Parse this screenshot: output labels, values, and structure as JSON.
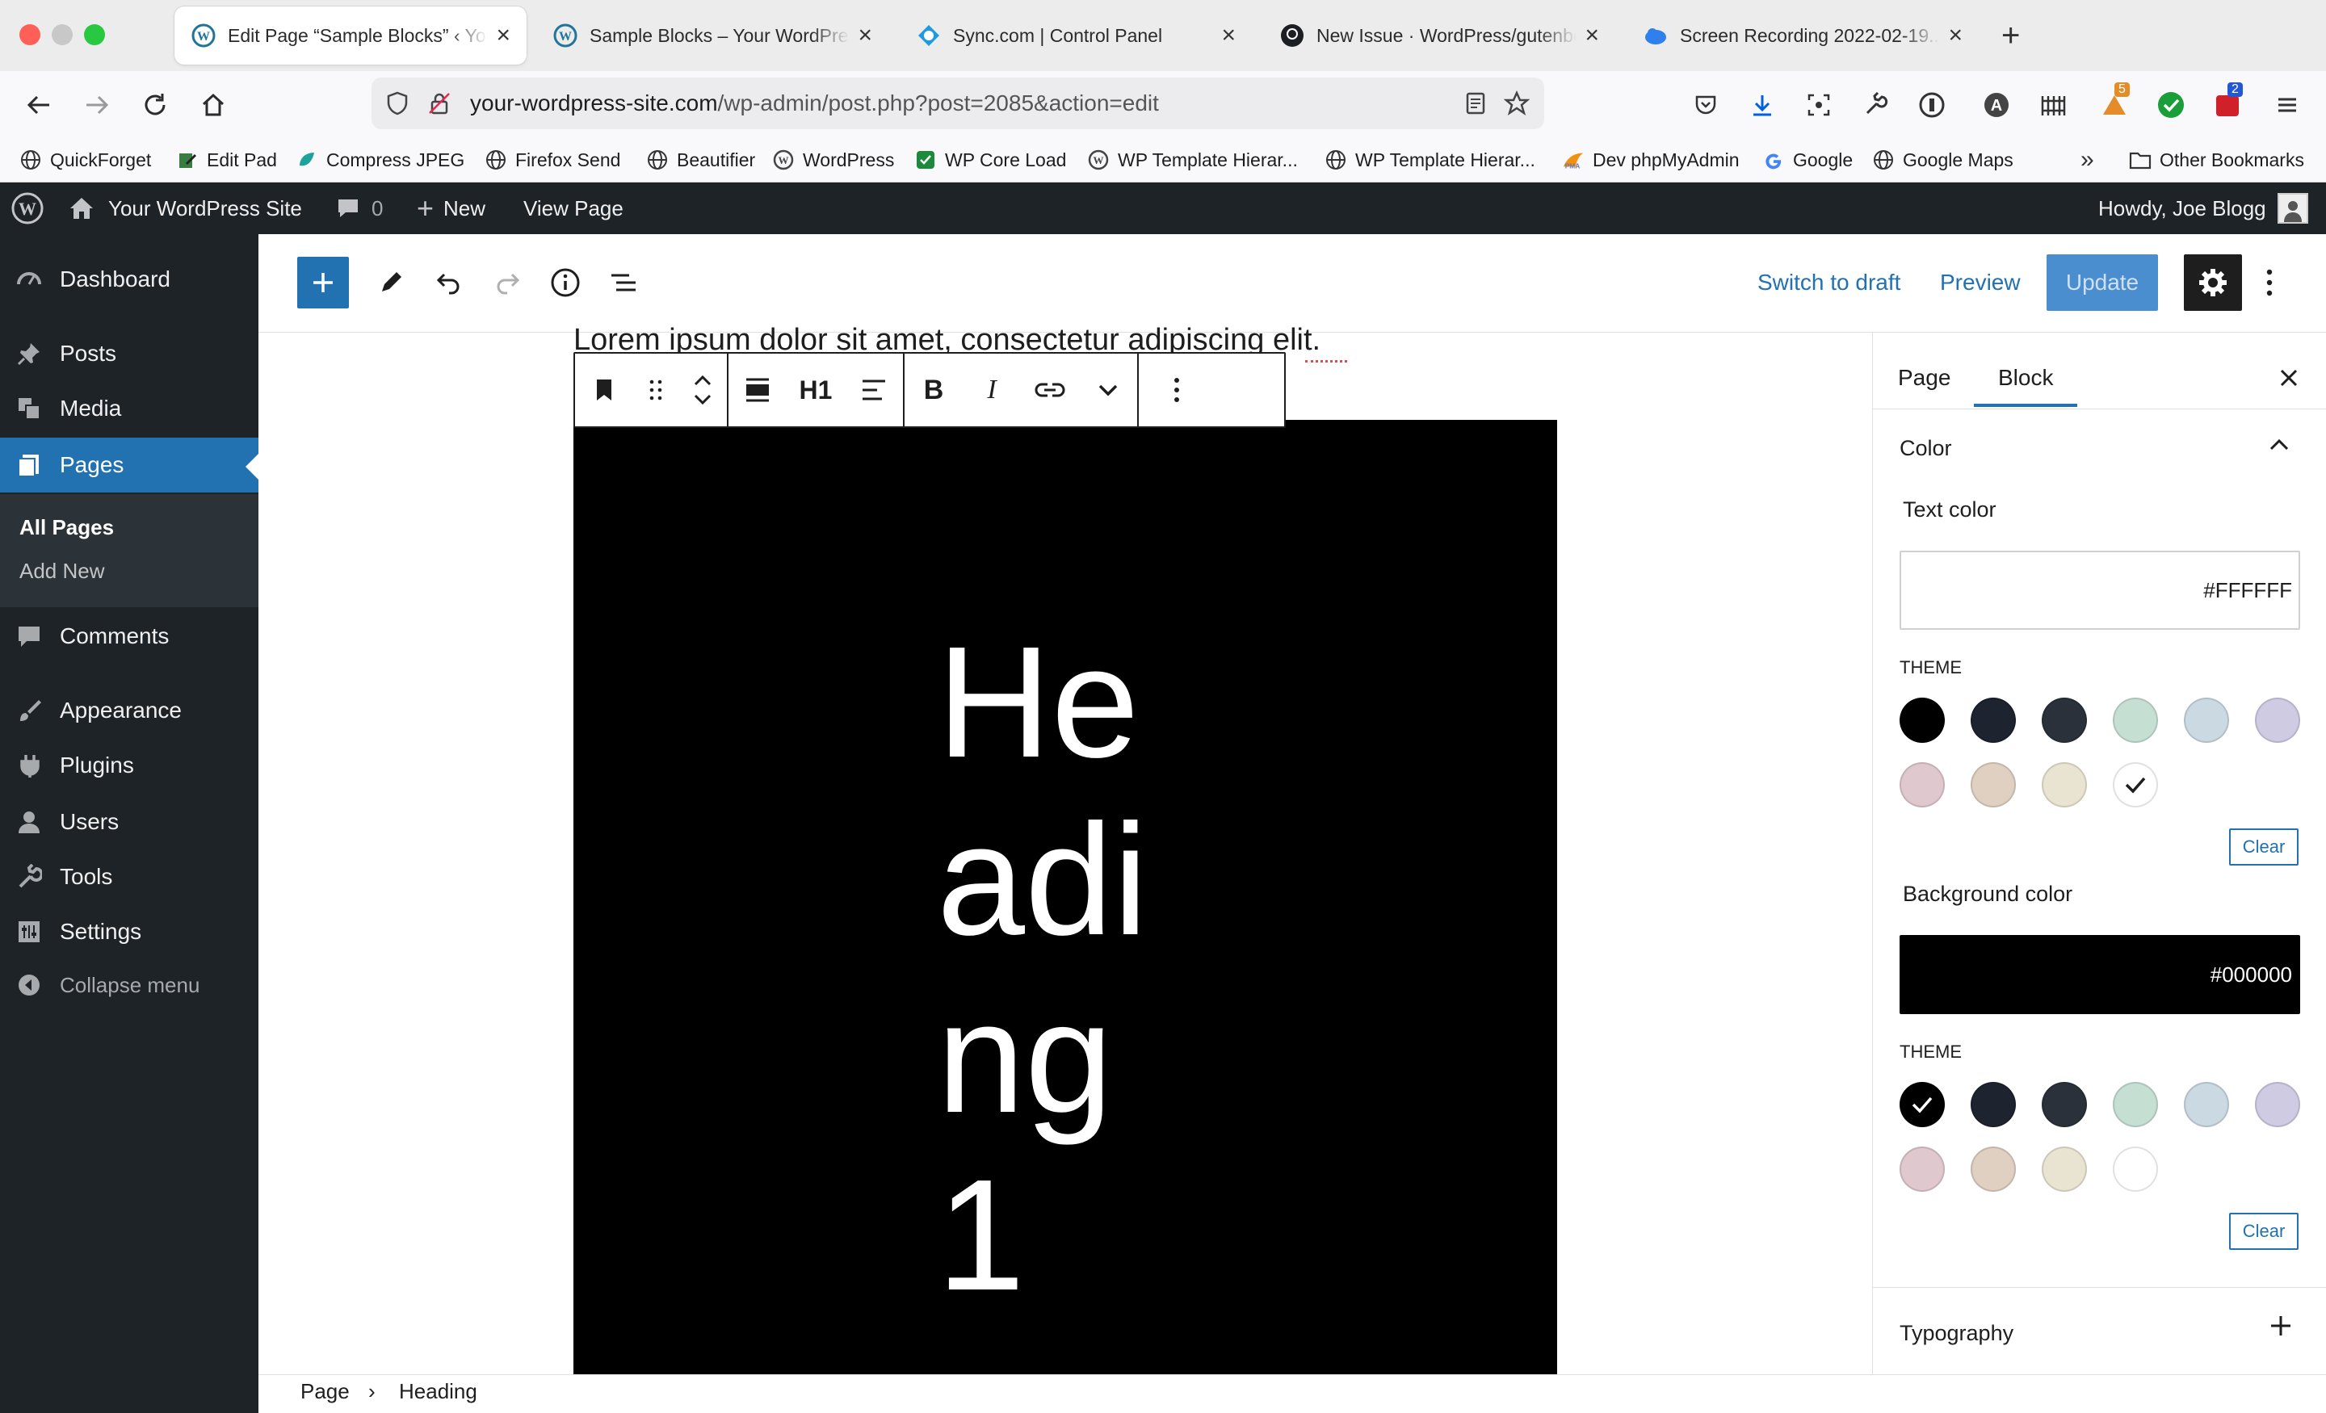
{
  "browser": {
    "tabs": [
      {
        "title": "Edit Page “Sample Blocks” ‹ Your WordPress Site",
        "favicon": "wordpress-icon",
        "active": true
      },
      {
        "title": "Sample Blocks – Your WordPress Site",
        "favicon": "wordpress-icon",
        "active": false
      },
      {
        "title": "Sync.com | Control Panel",
        "favicon": "sync-icon",
        "active": false
      },
      {
        "title": "New Issue · WordPress/gutenberg",
        "favicon": "github-icon",
        "active": false
      },
      {
        "title": "Screen Recording 2022-02-19...",
        "favicon": "cloudapp-icon",
        "active": false
      }
    ],
    "url_host": "your-wordpress-site.com",
    "url_path": "/wp-admin/post.php?post=2085&action=edit",
    "extension_badges": {
      "ext1": "5",
      "ext2": "2"
    },
    "bookmarks": [
      {
        "label": "QuickForget",
        "icon": "globe-icon"
      },
      {
        "label": "Edit Pad",
        "icon": "editpad-icon"
      },
      {
        "label": "Compress JPEG",
        "icon": "compress-icon"
      },
      {
        "label": "Firefox Send",
        "icon": "globe-icon"
      },
      {
        "label": "Beautifier",
        "icon": "globe-icon"
      },
      {
        "label": "WordPress",
        "icon": "wordpress-icon"
      },
      {
        "label": "WP Core Load",
        "icon": "wpcore-icon"
      },
      {
        "label": "WP Template Hierar...",
        "icon": "wordpress-icon"
      },
      {
        "label": "WP Template Hierar...",
        "icon": "globe-icon"
      },
      {
        "label": "Dev phpMyAdmin",
        "icon": "pma-icon"
      },
      {
        "label": "Google",
        "icon": "google-icon"
      },
      {
        "label": "Google Maps",
        "icon": "globe-icon"
      }
    ],
    "other_bookmarks": "Other Bookmarks"
  },
  "adminbar": {
    "site_name": "Your WordPress Site",
    "comments_count": "0",
    "new_label": "New",
    "view_label": "View Page",
    "howdy": "Howdy, Joe Blogg"
  },
  "sidebar": {
    "items": [
      {
        "label": "Dashboard",
        "icon": "dashboard-icon"
      },
      {
        "label": "Posts",
        "icon": "pin-icon"
      },
      {
        "label": "Media",
        "icon": "media-icon"
      },
      {
        "label": "Pages",
        "icon": "pages-icon"
      },
      {
        "label": "Comments",
        "icon": "comment-icon"
      },
      {
        "label": "Appearance",
        "icon": "brush-icon"
      },
      {
        "label": "Plugins",
        "icon": "plug-icon"
      },
      {
        "label": "Users",
        "icon": "user-icon"
      },
      {
        "label": "Tools",
        "icon": "wrench-icon"
      },
      {
        "label": "Settings",
        "icon": "settings-icon"
      },
      {
        "label": "Collapse menu",
        "icon": "collapse-icon"
      }
    ],
    "submenu": {
      "all_pages": "All Pages",
      "add_new": "Add New"
    }
  },
  "editor": {
    "header": {
      "switch_to_draft": "Switch to draft",
      "preview": "Preview",
      "update": "Update"
    },
    "lorem": "Lorem ipsum dolor sit amet, consectetur adipiscing elit.",
    "heading_text": "Heading 1",
    "toolbar": {
      "heading_level": "H1"
    },
    "breadcrumb": [
      "Page",
      "Heading"
    ]
  },
  "inspector": {
    "tabs": [
      "Page",
      "Block"
    ],
    "active_tab": "Block",
    "color_section": "Color",
    "text_color_label": "Text color",
    "text_color_value": "#FFFFFF",
    "theme_label": "THEME",
    "clear_label": "Clear",
    "background_color_label": "Background color",
    "background_color_value": "#000000",
    "theme_swatches": [
      "#000000",
      "#1e2330",
      "#2b313b",
      "#c5dfd3",
      "#cad9e2",
      "#cfcbe3",
      "#e0c8cf",
      "#dfd0c1",
      "#e9e4d1",
      "#ffffff"
    ],
    "text_selected_index": 9,
    "bg_selected_index": 0,
    "typography_section": "Typography"
  },
  "colors": {
    "wp_blue": "#2271b1",
    "admin_dark": "#1d2327"
  }
}
